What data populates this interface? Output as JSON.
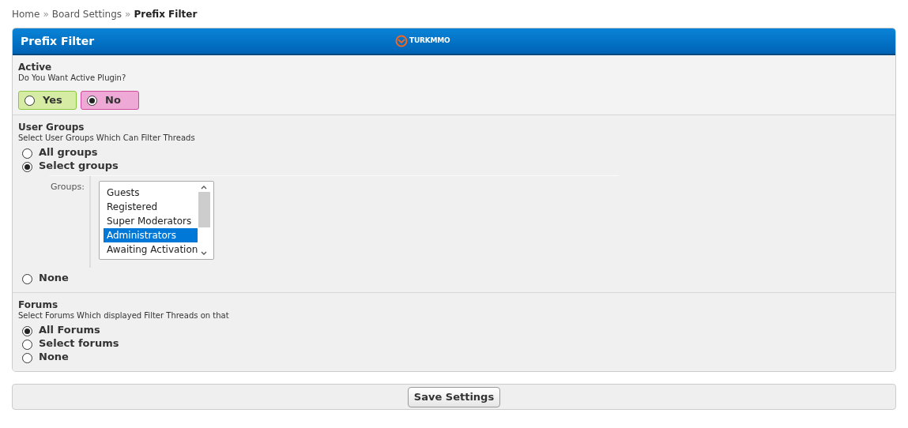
{
  "breadcrumb": [
    {
      "label": "Home",
      "current": false
    },
    {
      "label": "Board Settings",
      "current": false
    },
    {
      "label": "Prefix Filter",
      "current": true
    }
  ],
  "breadcrumb_separator": "»",
  "panel": {
    "title": "Prefix Filter",
    "logo_text": "TURKMMO"
  },
  "settings": [
    {
      "kind": "yesno",
      "title": "Active",
      "description": "Do You Want Active Plugin?",
      "options": [
        {
          "label": "Yes",
          "selected": false,
          "color": "#d6eba3"
        },
        {
          "label": "No",
          "selected": true,
          "color": "#efa9d7"
        }
      ]
    },
    {
      "kind": "radio",
      "title": "User Groups",
      "description": "Select User Groups Which Can Filter Threads",
      "options": [
        {
          "label": "All groups",
          "selected": false
        },
        {
          "label": "Select groups",
          "selected": true,
          "list_label": "Groups:",
          "list_items": [
            {
              "label": "Guests",
              "selected": false
            },
            {
              "label": "Registered",
              "selected": false
            },
            {
              "label": "Super Moderators",
              "selected": false
            },
            {
              "label": "Administrators",
              "selected": true
            },
            {
              "label": "Awaiting Activation",
              "selected": false
            }
          ]
        },
        {
          "label": "None",
          "selected": false
        }
      ]
    },
    {
      "kind": "radio",
      "title": "Forums",
      "description": "Select Forums Which displayed Filter Threads on that",
      "options": [
        {
          "label": "All Forums",
          "selected": true
        },
        {
          "label": "Select forums",
          "selected": false
        },
        {
          "label": "None",
          "selected": false
        }
      ]
    }
  ],
  "save_button": "Save Settings"
}
